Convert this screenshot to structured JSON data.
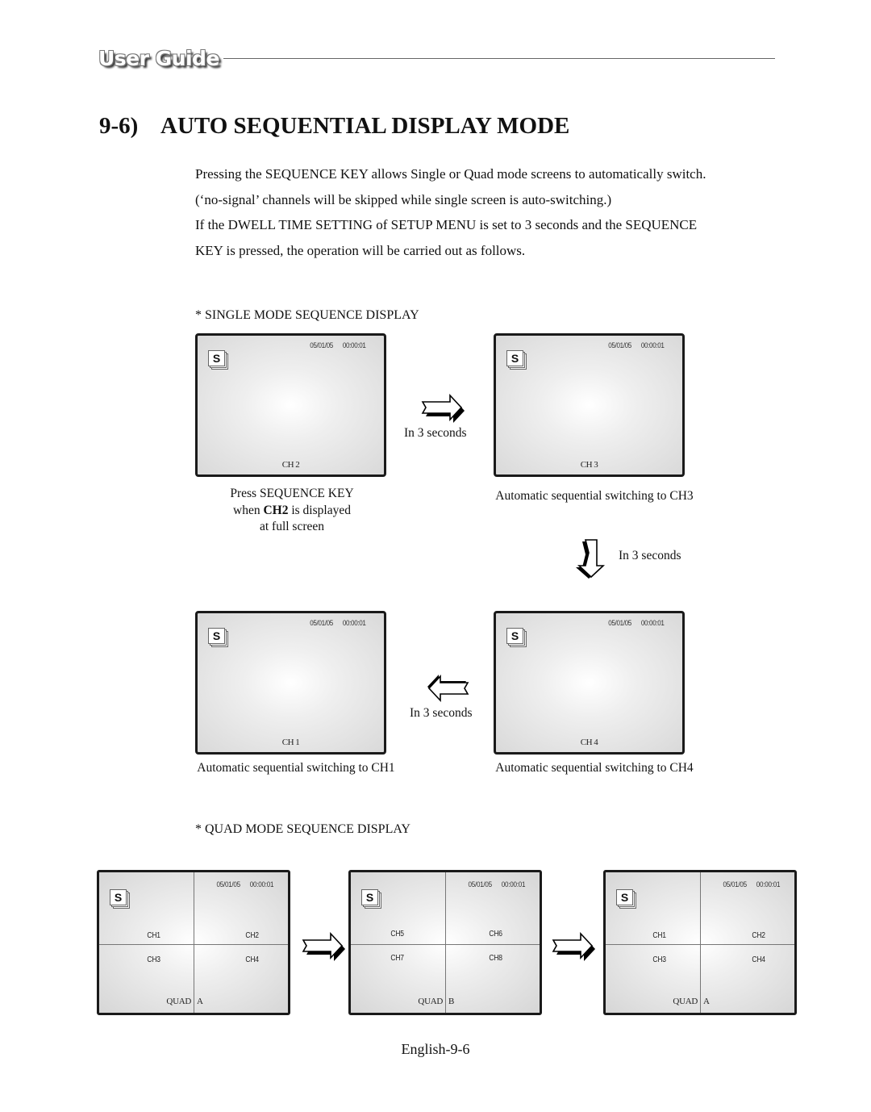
{
  "header": {
    "logo_text": "User Guide"
  },
  "section": {
    "number": "9-6)",
    "title": "AUTO SEQUENTIAL DISPLAY MODE"
  },
  "intro": {
    "lines": [
      "Pressing the SEQUENCE KEY allows Single or Quad mode screens to automatically switch.",
      "(‘no-signal’ channels will be skipped while single screen is auto-switching.)",
      "If the DWELL TIME SETTING of SETUP MENU is set to 3 seconds and the SEQUENCE",
      "KEY is pressed, the operation will be carried out as follows."
    ]
  },
  "single_mode": {
    "label": "* SINGLE MODE SEQUENCE DISPLAY",
    "screens": [
      {
        "icon": "S",
        "date": "05/01/05",
        "time": "00:00:01",
        "channel": "CH 2",
        "caption": {
          "line1": "Press SEQUENCE KEY",
          "line2_pre": "when ",
          "line2_bold": "CH2",
          "line2_post": " is displayed",
          "line3": "at full screen"
        }
      },
      {
        "icon": "S",
        "date": "05/01/05",
        "time": "00:00:01",
        "channel": "CH 3",
        "caption": "Automatic sequential switching to CH3"
      },
      {
        "icon": "S",
        "date": "05/01/05",
        "time": "00:00:01",
        "channel": "CH 4",
        "caption": "Automatic sequential switching to CH4"
      },
      {
        "icon": "S",
        "date": "05/01/05",
        "time": "00:00:01",
        "channel": "CH 1",
        "caption": "Automatic sequential switching to CH1"
      }
    ],
    "arrows": [
      {
        "direction": "right",
        "label": "In 3 seconds"
      },
      {
        "direction": "down",
        "label": "In 3 seconds"
      },
      {
        "direction": "left",
        "label": "In 3 seconds"
      }
    ]
  },
  "quad_mode": {
    "label": "* QUAD MODE SEQUENCE DISPLAY",
    "screens": [
      {
        "icon": "S",
        "date": "05/01/05",
        "time": "00:00:01",
        "channels": [
          "CH1",
          "CH2",
          "CH3",
          "CH4"
        ],
        "quad_label": "QUAD",
        "quad_group": "A"
      },
      {
        "icon": "S",
        "date": "05/01/05",
        "time": "00:00:01",
        "channels": [
          "CH5",
          "CH6",
          "CH7",
          "CH8"
        ],
        "quad_label": "QUAD",
        "quad_group": "B"
      },
      {
        "icon": "S",
        "date": "05/01/05",
        "time": "00:00:01",
        "channels": [
          "CH1",
          "CH2",
          "CH3",
          "CH4"
        ],
        "quad_label": "QUAD",
        "quad_group": "A"
      }
    ],
    "arrows": [
      {
        "direction": "right"
      },
      {
        "direction": "right"
      }
    ]
  },
  "footer": {
    "page_number": "English-9-6"
  }
}
